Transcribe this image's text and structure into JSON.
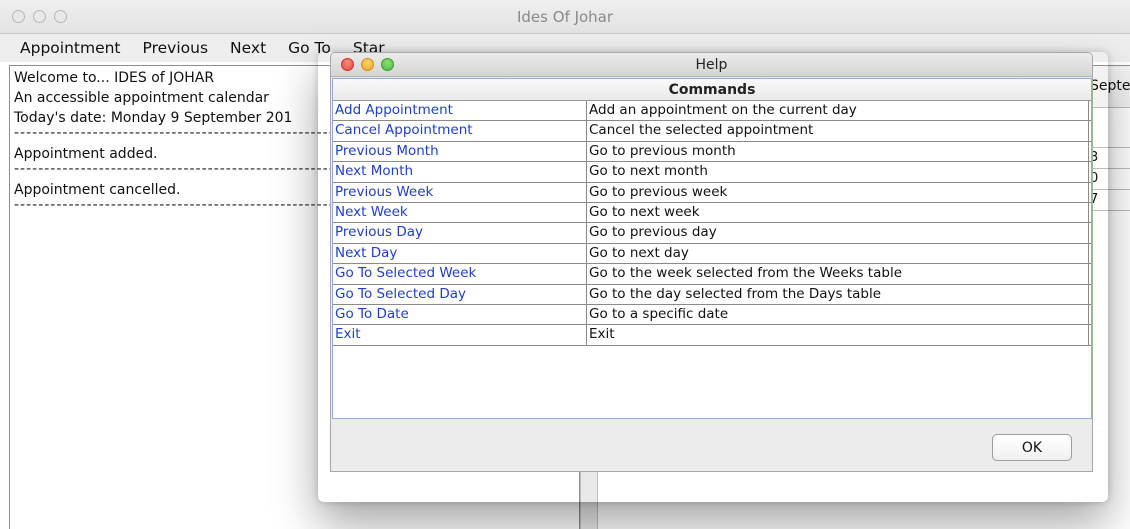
{
  "window": {
    "title": "Ides Of Johar"
  },
  "menu": {
    "items": [
      "Appointment",
      "Previous",
      "Next",
      "Go To",
      "Star"
    ]
  },
  "log": {
    "lines": [
      "Welcome to... IDES of JOHAR",
      "An accessible appointment calendar",
      "Today's date:  Monday 9 September 201"
    ],
    "entry1": "Appointment added.",
    "entry2": "Appointment cancelled.",
    "separator": "----------------------------------------------------------------"
  },
  "calendar": {
    "header_fragment": "Septe",
    "cells": [
      "3",
      "0",
      "7"
    ]
  },
  "help_dialog": {
    "title": "Help",
    "column_header": "Commands",
    "commands": [
      {
        "name": "Add Appointment",
        "description": "Add an appointment on the current day"
      },
      {
        "name": "Cancel Appointment",
        "description": "Cancel the selected appointment"
      },
      {
        "name": "Previous Month",
        "description": "Go to previous month"
      },
      {
        "name": "Next Month",
        "description": "Go to next month"
      },
      {
        "name": "Previous Week",
        "description": "Go to previous week"
      },
      {
        "name": "Next Week",
        "description": "Go to next week"
      },
      {
        "name": "Previous Day",
        "description": "Go to previous day"
      },
      {
        "name": "Next Day",
        "description": "Go to next day"
      },
      {
        "name": "Go To Selected Week",
        "description": "Go to the week selected from the Weeks table"
      },
      {
        "name": "Go To Selected Day",
        "description": "Go to the day selected from the Days table"
      },
      {
        "name": "Go To Date",
        "description": "Go to a specific date"
      },
      {
        "name": "Exit",
        "description": "Exit"
      }
    ],
    "ok_label": "OK"
  },
  "colors": {
    "command_link": "#1f3fc8",
    "close": "#e0443a",
    "minimize": "#e9a526",
    "zoom": "#4bb63a"
  }
}
